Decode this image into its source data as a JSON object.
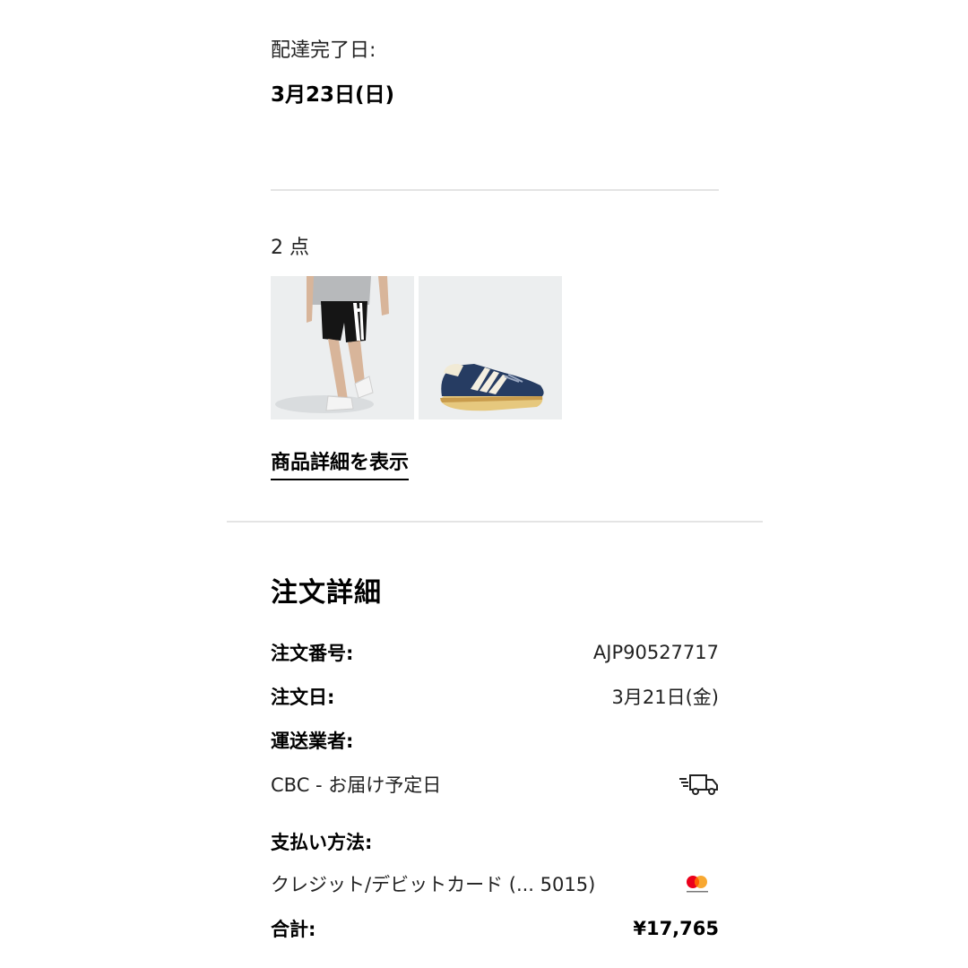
{
  "delivery": {
    "label": "配達完了日:",
    "date": "3月23日(日)"
  },
  "items": {
    "count_label": "2 点",
    "thumbnails": [
      {
        "name": "black-shorts-product",
        "alt": "ショーツ"
      },
      {
        "name": "navy-sneakers-product",
        "alt": "スニーカー"
      }
    ],
    "details_link": "商品詳細を表示"
  },
  "order": {
    "title": "注文詳細",
    "number_label": "注文番号:",
    "number_value": "AJP90527717",
    "date_label": "注文日:",
    "date_value": "3月21日(金)",
    "carrier_label": "運送業者:",
    "carrier_value": "CBC - お届け予定日",
    "carrier_icon": "delivery-truck-icon",
    "payment_label": "支払い方法:",
    "payment_value": "クレジット/デビットカード (... 5015)",
    "payment_icon": "mastercard-icon",
    "total_label": "合計:",
    "total_value": "¥17,765"
  },
  "colors": {
    "text": "#111111",
    "divider": "#e4e4e4",
    "thumb_bg": "#eceeef",
    "mastercard_red": "#eb001b",
    "mastercard_orange": "#f79e1b"
  }
}
